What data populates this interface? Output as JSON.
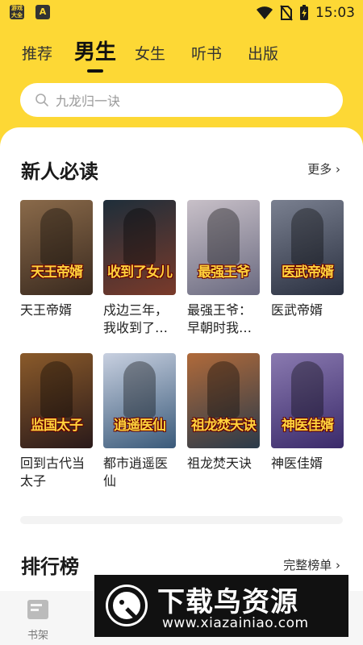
{
  "status_bar": {
    "app_icon_1": "游戏\n大全",
    "app_icon_2": "A",
    "time": "15:03"
  },
  "tabs": [
    {
      "label": "推荐",
      "active": false
    },
    {
      "label": "男生",
      "active": true
    },
    {
      "label": "女生",
      "active": false
    },
    {
      "label": "听书",
      "active": false
    },
    {
      "label": "出版",
      "active": false
    }
  ],
  "search": {
    "placeholder": "九龙归一诀"
  },
  "section_new": {
    "title": "新人必读",
    "more_label": "更多",
    "books": [
      {
        "title": "天王帝婿",
        "cover_text": "天王帝婿",
        "color_a": "#3a2a1f",
        "color_b": "#8a6a4a"
      },
      {
        "title": "戍边三年，我收到了…",
        "cover_text": "收到了女儿",
        "color_a": "#1e2e3a",
        "color_b": "#7a3a2a"
      },
      {
        "title": "最强王爷：早朝时我…",
        "cover_text": "最强王爷",
        "color_a": "#6a6a80",
        "color_b": "#c8c0c8"
      },
      {
        "title": "医武帝婿",
        "cover_text": "医武帝婿",
        "color_a": "#2a3040",
        "color_b": "#7a8090"
      },
      {
        "title": "回到古代当太子",
        "cover_text": "监国太子",
        "color_a": "#2a1a1a",
        "color_b": "#8a5a2a"
      },
      {
        "title": "都市逍遥医仙",
        "cover_text": "逍遥医仙",
        "color_a": "#3a5a7a",
        "color_b": "#c8d0e0"
      },
      {
        "title": "祖龙焚天诀",
        "cover_text": "祖龙焚天诀",
        "color_a": "#2a3a4a",
        "color_b": "#b06a3a"
      },
      {
        "title": "神医佳婿",
        "cover_text": "神医佳婿",
        "color_a": "#3a2a6a",
        "color_b": "#8a7ab0"
      }
    ]
  },
  "section_rank": {
    "title": "排行榜",
    "more_label": "完整榜单"
  },
  "bottom_nav": [
    {
      "label": "书架"
    }
  ],
  "watermark": {
    "title": "下载鸟资源",
    "url": "www.xiazainiao.com"
  }
}
